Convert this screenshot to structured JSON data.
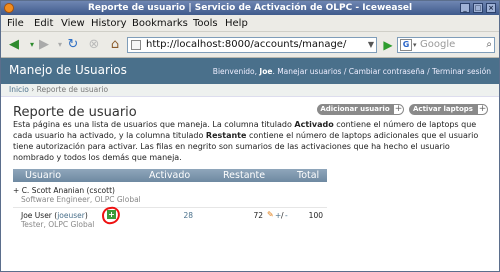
{
  "window": {
    "title": "Reporte de usuario | Servicio de Activación de OLPC - Iceweasel"
  },
  "menu": {
    "items": [
      "File",
      "Edit",
      "View",
      "History",
      "Bookmarks",
      "Tools",
      "Help"
    ]
  },
  "nav": {
    "url": "http://localhost:8000/accounts/manage/",
    "search_placeholder": "Google"
  },
  "site": {
    "brand": "Manejo de Usuarios",
    "welcome_prefix": "Bienvenido, ",
    "user": "Joe",
    "links": ". Manejar usuarios / Cambiar contraseña / Terminar sesión"
  },
  "breadcrumb": {
    "home": "Inicio",
    "sep": " › ",
    "current": "Reporte de usuario"
  },
  "page": {
    "title": "Reporte de usuario",
    "add_user_label": "Adicionar usuario",
    "activate_laptops_label": "Activar laptops",
    "plus": "+",
    "description_1": "Esta página es una lista de usuarios que maneja. La columna titulado ",
    "description_bold_1": "Activado",
    "description_2": " contiene el número de laptops que cada usuario ha activado, y la columna titulado ",
    "description_bold_2": "Restante",
    "description_3": " contiene el número de laptops adicionales que el usuario tiene autorización para activar. Las filas en negrito son sumarios de las activaciones que ha hecho el usuario nombrado y todos los demás que maneja."
  },
  "table": {
    "headers": {
      "user": "Usuario",
      "activated": "Activado",
      "remaining": "Restante",
      "total": "Total"
    },
    "rows": [
      {
        "expander": "+",
        "name": "C. Scott Ananian (cscott)",
        "subtitle": "Software Engineer, OLPC Global",
        "activated": "",
        "remaining": "",
        "total": ""
      },
      {
        "name": "Joe User (",
        "login": "joeuser",
        "name_end": ")",
        "subtitle": "Tester, OLPC Global",
        "activated": "28",
        "remaining": "72",
        "total": "100",
        "increment": "+",
        "separator": "/",
        "decrement": "-"
      }
    ]
  }
}
